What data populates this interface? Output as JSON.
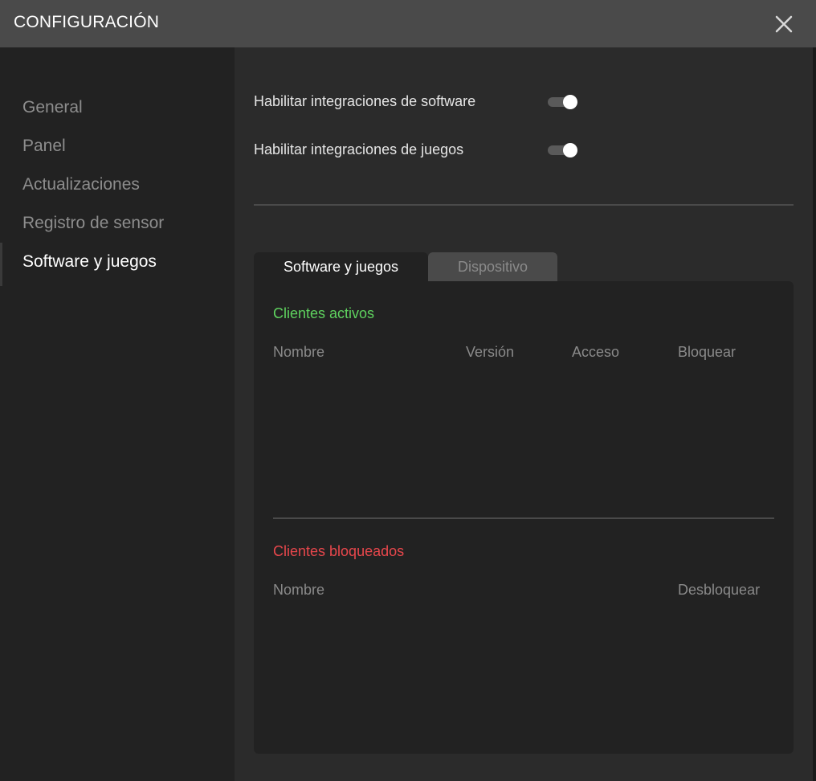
{
  "window": {
    "title": "CONFIGURACIÓN"
  },
  "sidebar": {
    "items": [
      {
        "label": "General"
      },
      {
        "label": "Panel"
      },
      {
        "label": "Actualizaciones"
      },
      {
        "label": "Registro de sensor"
      },
      {
        "label": "Software y juegos",
        "active": true
      }
    ]
  },
  "settings": {
    "software_integrations": {
      "label": "Habilitar integraciones de software",
      "enabled": true
    },
    "game_integrations": {
      "label": "Habilitar integraciones de juegos",
      "enabled": true
    }
  },
  "tabs": [
    {
      "label": "Software y juegos",
      "active": true
    },
    {
      "label": "Dispositivo",
      "active": false
    }
  ],
  "active_clients": {
    "title": "Clientes activos",
    "title_color": "#5fd35f",
    "columns": [
      "Nombre",
      "Versión",
      "Acceso",
      "Bloquear"
    ],
    "rows": []
  },
  "blocked_clients": {
    "title": "Clientes bloqueados",
    "title_color": "#e8474c",
    "columns": [
      "Nombre",
      "Desbloquear"
    ],
    "rows": []
  },
  "icons": {
    "close": "close-icon"
  }
}
